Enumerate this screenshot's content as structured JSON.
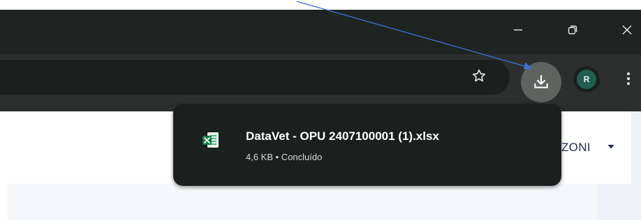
{
  "window": {
    "minimize_icon": "minimize-icon",
    "restore_icon": "restore-icon",
    "close_icon": "close-icon"
  },
  "toolbar": {
    "bookmark_icon": "star-icon",
    "downloads_icon": "download-icon",
    "profile_initial": "R",
    "menu_icon": "kebab-menu-icon"
  },
  "download": {
    "file_name": "DataVet - OPU 2407100001 (1).xlsx",
    "status": "4,6 KB • Concluído",
    "file_icon": "excel-file-icon"
  },
  "page": {
    "user_name_partial": "ZONI",
    "user_menu_icon": "caret-down-icon"
  },
  "colors": {
    "titlebar": "#1e2422",
    "toolbar": "#2b302e",
    "bubble": "#1b201e",
    "annotation_arrow": "#3b6fd6"
  }
}
